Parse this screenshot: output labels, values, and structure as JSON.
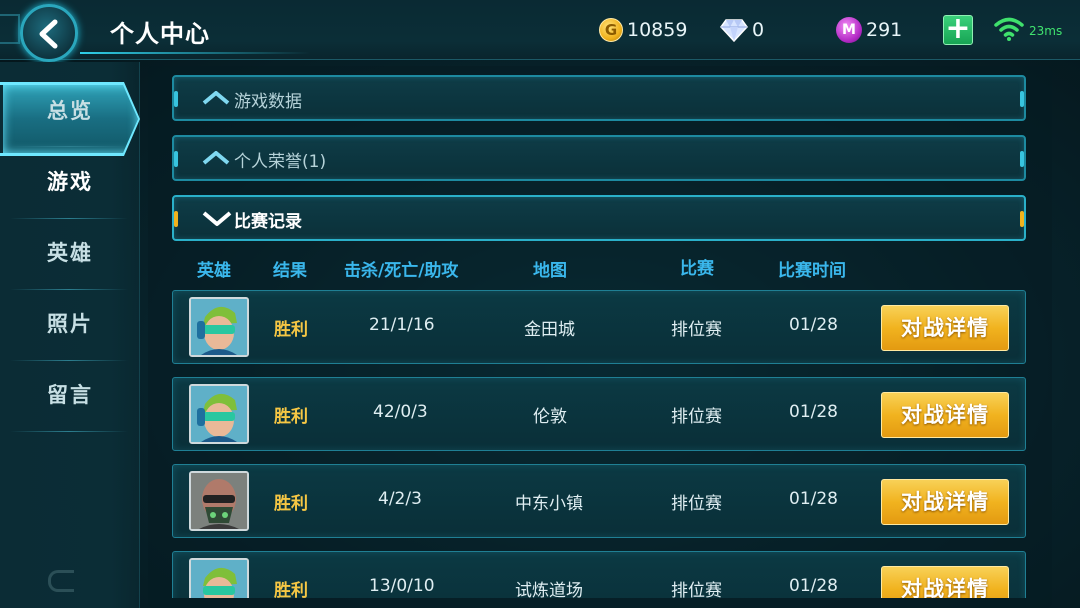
{
  "header": {
    "title": "个人中心",
    "gold": "10859",
    "diamonds": "0",
    "vouchers": "291",
    "ping": "23ms",
    "coin_letter": "G",
    "voucher_letter": "M"
  },
  "sidebar": {
    "items": [
      {
        "label": "总览",
        "active": false
      },
      {
        "label": "游戏",
        "active": true
      },
      {
        "label": "英雄",
        "active": false
      },
      {
        "label": "照片",
        "active": false
      },
      {
        "label": "留言",
        "active": false
      }
    ]
  },
  "sections": [
    {
      "label": "游戏数据",
      "expanded": false
    },
    {
      "label": "个人荣誉(1)",
      "expanded": false
    },
    {
      "label": "比赛记录",
      "expanded": true
    }
  ],
  "table": {
    "headers": [
      "英雄",
      "结果",
      "击杀/死亡/助攻",
      "地图",
      "比赛",
      "比赛时间"
    ],
    "rows": [
      {
        "result": "胜利",
        "kda": "21/1/16",
        "map": "金田城",
        "mode": "排位赛",
        "date": "01/28",
        "button": "对战详情",
        "hero": "green-visor-hero"
      },
      {
        "result": "胜利",
        "kda": "42/0/3",
        "map": "伦敦",
        "mode": "排位赛",
        "date": "01/28",
        "button": "对战详情",
        "hero": "green-visor-hero"
      },
      {
        "result": "胜利",
        "kda": "4/2/3",
        "map": "中东小镇",
        "mode": "排位赛",
        "date": "01/28",
        "button": "对战详情",
        "hero": "masked-hero"
      },
      {
        "result": "胜利",
        "kda": "13/0/10",
        "map": "试炼道场",
        "mode": "排位赛",
        "date": "01/28",
        "button": "对战详情",
        "hero": "green-visor-hero"
      }
    ]
  },
  "colors": {
    "accent_cyan": "#3ab7ec",
    "win_gold": "#f6c744",
    "button_gold": "#f1b31f",
    "ping_green": "#40e36f"
  }
}
